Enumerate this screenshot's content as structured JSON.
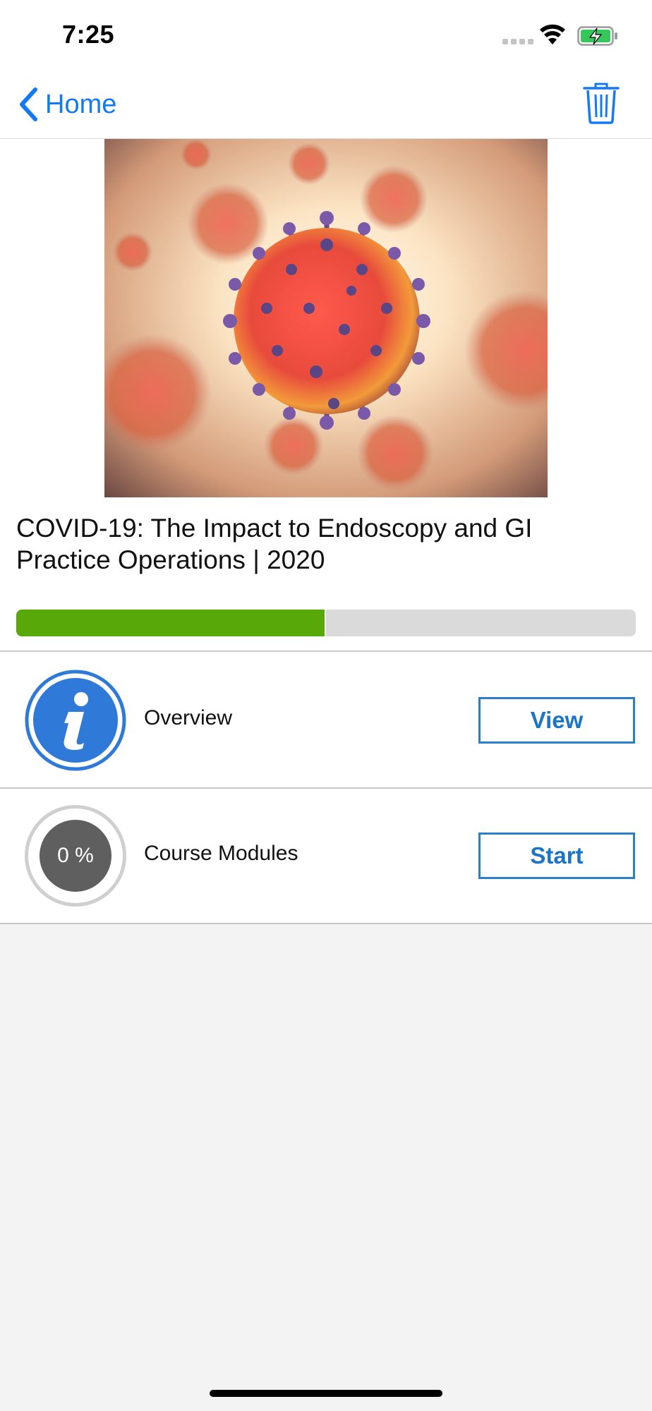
{
  "status_bar": {
    "time": "7:25",
    "icons": [
      "signal-dots-icon",
      "wifi-icon",
      "battery-charging-icon"
    ]
  },
  "nav": {
    "back_label": "Home",
    "back_icon": "chevron-left-icon",
    "action_icon": "trash-icon"
  },
  "course": {
    "image_subject": "coronavirus-illustration",
    "title": "COVID-19: The Impact to Endoscopy and GI Practice Operations | 2020",
    "progress": 0.5
  },
  "rows": [
    {
      "label": "Overview",
      "icon": "info-icon",
      "button": "View"
    },
    {
      "label": "Course Modules",
      "percent": "0 %",
      "button": "Start"
    }
  ],
  "colors": {
    "accent": "#1479f5",
    "progress_fill": "#58a80a",
    "progress_track": "#dadada",
    "button_border": "#2d7dc8",
    "background": "#f3f3f3"
  }
}
